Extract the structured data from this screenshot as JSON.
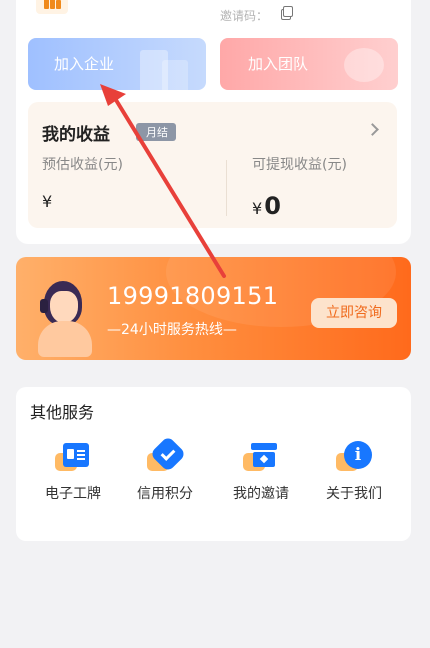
{
  "header": {
    "invite_label": "邀请码："
  },
  "join": {
    "company_label": "加入企业",
    "team_label": "加入团队"
  },
  "income": {
    "title": "我的收益",
    "badge": "月结",
    "estimated_label": "预估收益(元)",
    "estimated_value": "¥",
    "withdrawable_label": "可提现收益(元)",
    "withdrawable_symbol": "¥",
    "withdrawable_value": "0"
  },
  "hotline": {
    "phone": "19991809151",
    "subtitle": "—24小时服务热线—",
    "consult_button": "立即咨询"
  },
  "services": {
    "title": "其他服务",
    "items": [
      {
        "label": "电子工牌",
        "icon": "id-badge-icon"
      },
      {
        "label": "信用积分",
        "icon": "credit-check-icon"
      },
      {
        "label": "我的邀请",
        "icon": "invite-box-icon"
      },
      {
        "label": "关于我们",
        "icon": "info-icon"
      }
    ]
  },
  "colors": {
    "accent_blue": "#1877ff",
    "hotline_orange": "#ff6a1c",
    "annotation_red": "#e8403a"
  }
}
